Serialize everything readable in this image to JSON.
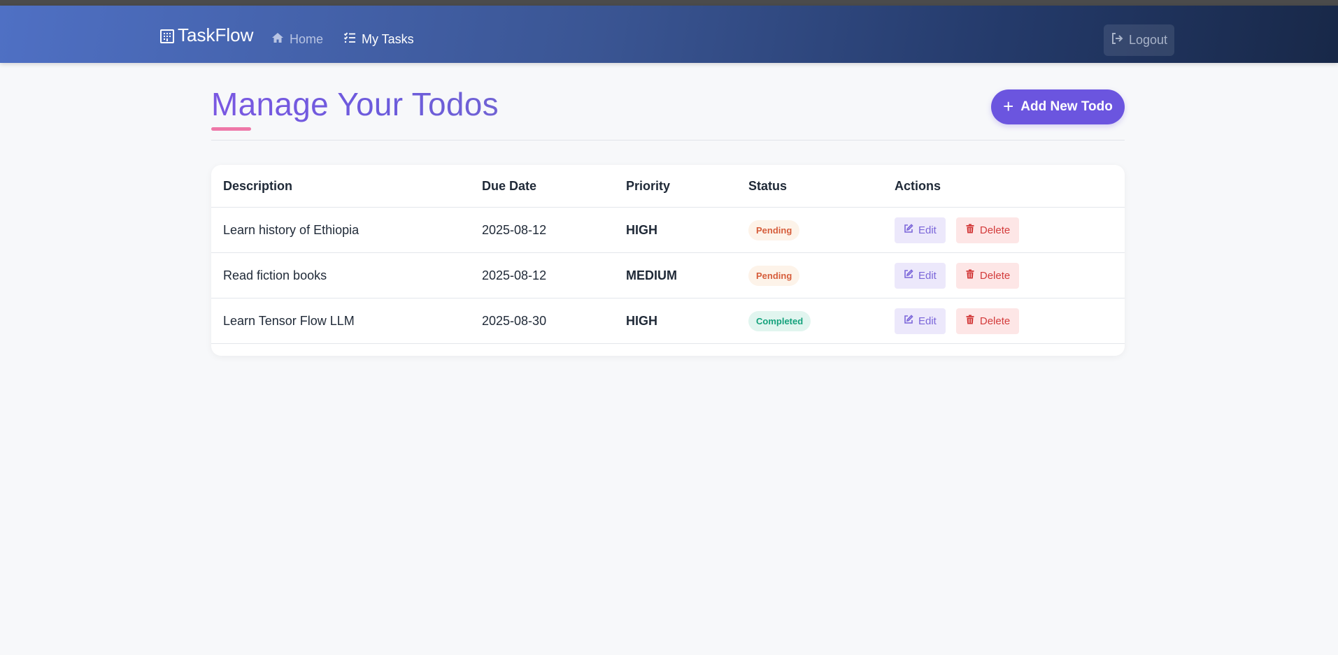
{
  "navbar": {
    "brand": "TaskFlow",
    "links": [
      {
        "label": "Home",
        "icon": "home-icon"
      },
      {
        "label": "My Tasks",
        "icon": "list-check-icon"
      }
    ],
    "logout_label": "Logout"
  },
  "page": {
    "title": "Manage Your Todos",
    "add_button_label": "Add New Todo"
  },
  "table": {
    "headers": [
      "Description",
      "Due Date",
      "Priority",
      "Status",
      "Actions"
    ],
    "rows": [
      {
        "description": "Learn history of Ethiopia",
        "due_date": "2025-08-12",
        "priority": "HIGH",
        "status": "Pending",
        "edit_label": "Edit",
        "delete_label": "Delete"
      },
      {
        "description": "Read fiction books",
        "due_date": "2025-08-12",
        "priority": "MEDIUM",
        "status": "Pending",
        "edit_label": "Edit",
        "delete_label": "Delete"
      },
      {
        "description": "Learn Tensor Flow LLM",
        "due_date": "2025-08-30",
        "priority": "HIGH",
        "status": "Completed",
        "edit_label": "Edit",
        "delete_label": "Delete"
      }
    ]
  },
  "colors": {
    "accent": "#6b55df",
    "underline": "#ee78a8",
    "pending_text": "#d65e3c",
    "completed_text": "#16a27d",
    "delete_text": "#d33b3b"
  }
}
